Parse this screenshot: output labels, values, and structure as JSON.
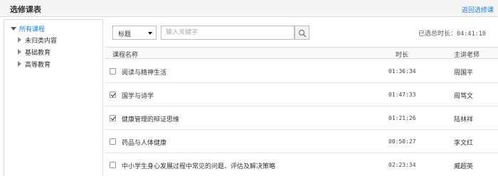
{
  "header": {
    "title": "选修课表",
    "back_link": "返回选修课"
  },
  "sidebar": {
    "root": "所有课程",
    "items": [
      {
        "label": "未归类内容"
      },
      {
        "label": "基础教育"
      },
      {
        "label": "高等教育"
      }
    ]
  },
  "toolbar": {
    "select_value": "标题",
    "search_placeholder": "输入关键字",
    "total_label": "已选总时长：",
    "total_time": "04:41:10"
  },
  "table": {
    "headers": {
      "name": "课程名称",
      "duration": "时长",
      "teacher": "主讲老师"
    },
    "rows": [
      {
        "name": "阅读与精神生活",
        "duration": "01:36:34",
        "teacher": "周国平",
        "checked": false
      },
      {
        "name": "国学与诗学",
        "duration": "01:47:33",
        "teacher": "周笃文",
        "checked": true
      },
      {
        "name": "健康管理的辩证思维",
        "duration": "01:21:26",
        "teacher": "陆林祥",
        "checked": true
      },
      {
        "name": "药品与人体健康",
        "duration": "00:50:27",
        "teacher": "李文红",
        "checked": false
      },
      {
        "name": "中小学生身心发展过程中常见的问题、评估及解决策略",
        "duration": "02:23:34",
        "teacher": "臧超英",
        "checked": false
      }
    ]
  }
}
